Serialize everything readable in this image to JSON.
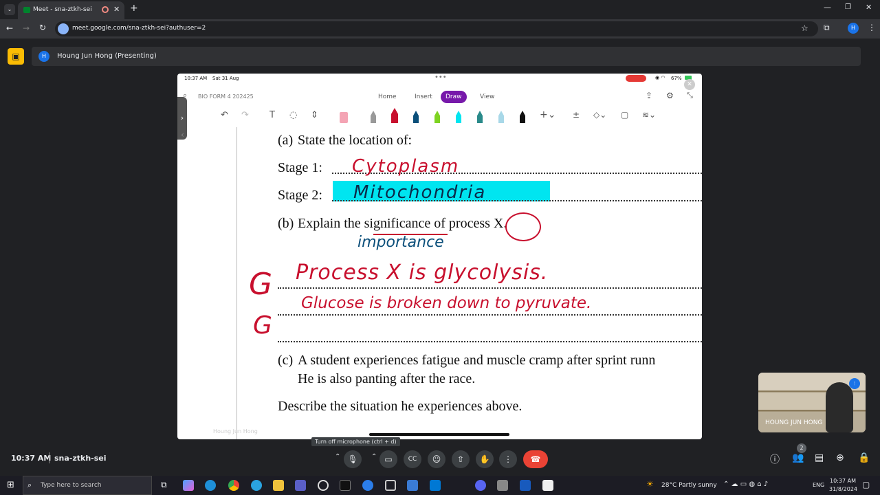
{
  "browser": {
    "tab_title": "Meet - sna-ztkh-sei",
    "url": "meet.google.com/sna-ztkh-sei?authuser=2",
    "profile_initial": "H"
  },
  "meet": {
    "presenter_initial": "H",
    "presenter_label": "Houng Jun Hong (Presenting)",
    "time": "10:37 AM",
    "meeting_code": "sna-ztkh-sei",
    "mic_tooltip": "Turn off microphone (ctrl + d)",
    "participants_count": "2",
    "self_name": "HOUNG JUN HONG"
  },
  "ipad": {
    "status_time": "10:37 AM",
    "status_date": "Sat 31 Aug",
    "battery": "67%",
    "notebook": "BIO FORM 4 202425",
    "tabs": [
      "Home",
      "Insert",
      "Draw",
      "View"
    ],
    "active_tab": "Draw",
    "watermark": "Houng Jun Hong"
  },
  "document": {
    "a_label": "(a)",
    "a_text": "State the location of:",
    "stage1": "Stage 1:",
    "stage2": "Stage 2:",
    "b_label": "(b)",
    "b_text": "Explain the significance of process X.",
    "c_label": "(c)",
    "c_text1": "A student experiences fatigue and muscle cramp after sprint runn",
    "c_text2": "He is also panting after the race.",
    "d_text": "Describe the situation he experiences above."
  },
  "handwriting": {
    "stage1": "Cytoplasm",
    "stage2": "Mitochondria",
    "importance": "importance",
    "line1": "Process X is glycolysis.",
    "line2": "Glucose is broken down to pyruvate.",
    "margin1": "G",
    "margin2": "G"
  },
  "taskbar": {
    "search_placeholder": "Type here to search",
    "weather": "28°C  Partly sunny",
    "lang": "ENG",
    "clock_time": "10:37 AM",
    "clock_date": "31/8/2024"
  },
  "colors": {
    "highlight": "#00e5f0",
    "draw_tab": "#7719aa",
    "end_call": "#ea4335",
    "ink_red": "#c8102e",
    "ink_blue": "#0b4f7a"
  }
}
